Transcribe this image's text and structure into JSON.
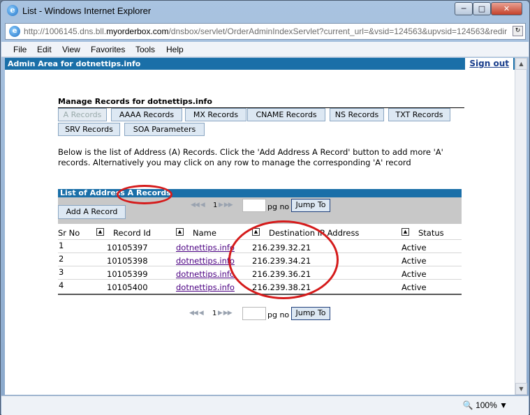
{
  "window": {
    "title": "List - Windows Internet Explorer",
    "address": "http://1006145.dns.bll.myorderbox.com/dnsbox/servlet/OrderAdminIndexServlet?current_url=&vsid=124563&upvsid=124563&redir",
    "address_prefix": "http://1006145.dns.bll.",
    "address_domain": "myorderbox.com",
    "address_suffix": "/dnsbox/servlet/OrderAdminIndexServlet?current_url=&vsid=124563&upvsid=124563&redir",
    "zoom": "100%"
  },
  "menu": [
    "File",
    "Edit",
    "View",
    "Favorites",
    "Tools",
    "Help"
  ],
  "page": {
    "admin_area": "Admin Area for dotnettips.info",
    "signout": "Sign out",
    "section_title": "Manage Records for dotnettips.info",
    "record_tabs": [
      "A Records",
      "AAAA Records",
      "MX Records",
      "CNAME Records",
      "NS Records",
      "TXT Records",
      "SRV Records",
      "SOA Parameters"
    ],
    "description": "Below is the list of Address (A) Records. Click the 'Add Address A Record' button to add more 'A' records. Alternatively you may click on any row to manage the corresponding 'A' record",
    "list_title": "List of Address A Records",
    "add_button": "Add A Record",
    "pager": {
      "page": "1",
      "pg_label": "pg no",
      "jump_label": "Jump To"
    },
    "columns": [
      "Sr No",
      "Record Id",
      "Name",
      "Destination IP Address",
      "Status"
    ],
    "rows": [
      {
        "sr": "1",
        "id": "10105397",
        "name": "dotnettips.info",
        "ip": "216.239.32.21",
        "status": "Active"
      },
      {
        "sr": "2",
        "id": "10105398",
        "name": "dotnettips.info",
        "ip": "216.239.34.21",
        "status": "Active"
      },
      {
        "sr": "3",
        "id": "10105399",
        "name": "dotnettips.info",
        "ip": "216.239.36.21",
        "status": "Active"
      },
      {
        "sr": "4",
        "id": "10105400",
        "name": "dotnettips.info",
        "ip": "216.239.38.21",
        "status": "Active"
      }
    ]
  },
  "colors": {
    "header_blue": "#1a6fa8",
    "annotation_red": "#d51b1b",
    "link_purple": "#4b0082"
  }
}
